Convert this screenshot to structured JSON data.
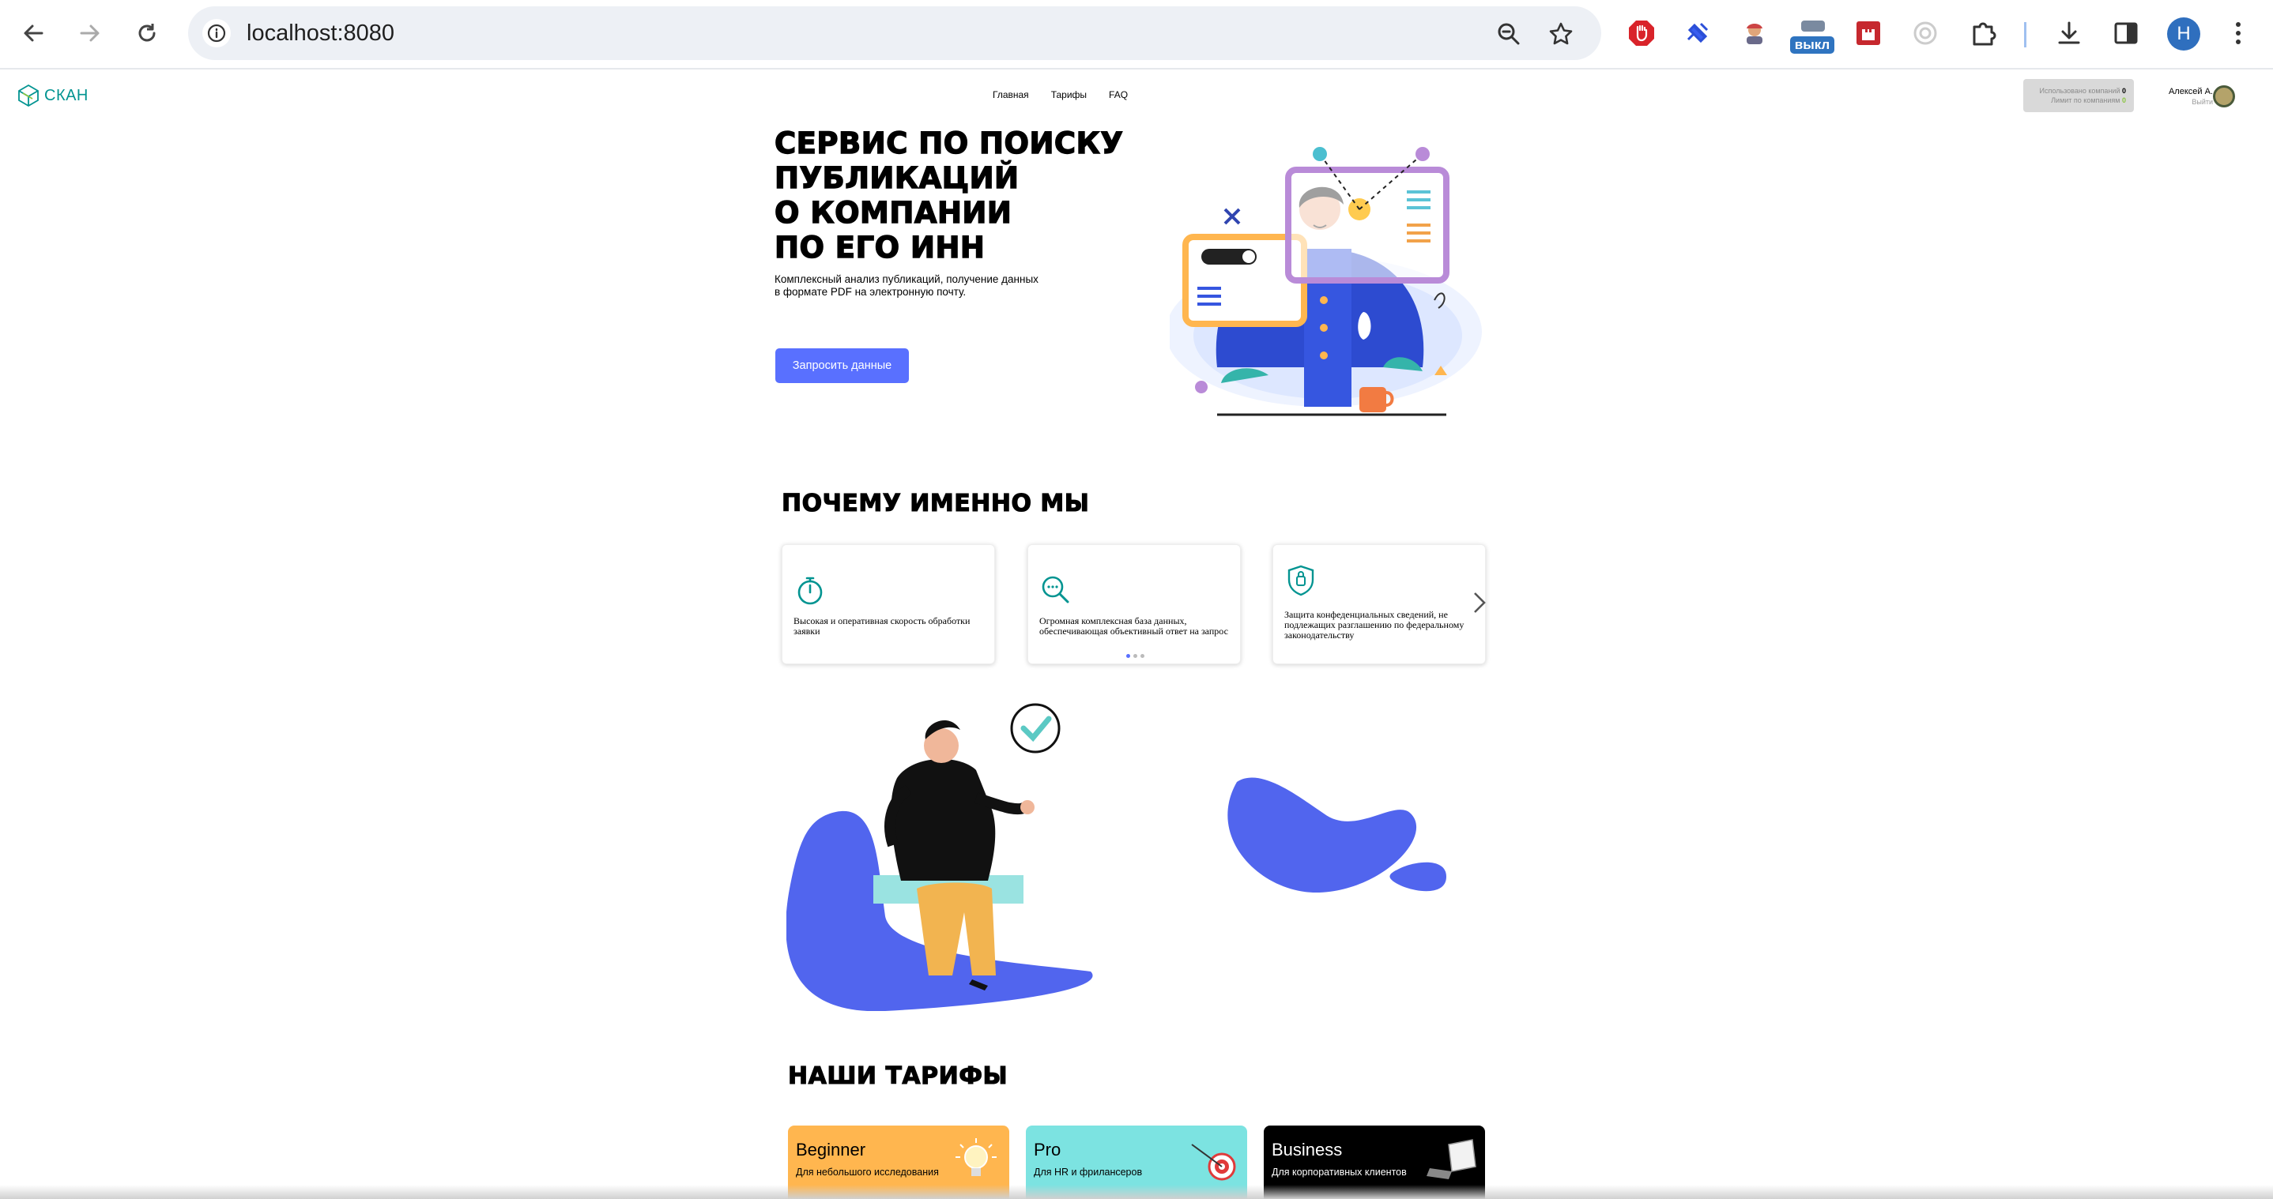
{
  "browser": {
    "url": "localhost:8080",
    "extension_badge": "выкл",
    "profile_initial": "H"
  },
  "site": {
    "logo_text": "СКАН",
    "nav": [
      "Главная",
      "Тарифы",
      "FAQ"
    ],
    "usage": {
      "used_label": "Использовано компаний",
      "used_value": "0",
      "limit_label": "Лимит по компаниям",
      "limit_value": "0"
    },
    "user": {
      "name": "Алексей А.",
      "logout": "Выйти"
    }
  },
  "hero": {
    "title_lines": [
      "СЕРВИС ПО ПОИСКУ",
      "ПУБЛИКАЦИЙ",
      "О КОМПАНИИ",
      "ПО ЕГО ИНН"
    ],
    "subtitle_lines": [
      "Комплексный анализ публикаций, получение данных",
      "в формате PDF на электронную почту."
    ],
    "cta": "Запросить данные"
  },
  "why": {
    "title": "ПОЧЕМУ ИМЕННО МЫ",
    "cards": [
      {
        "icon": "timer-icon",
        "text": "Высокая и оперативная скорость обработки заявки"
      },
      {
        "icon": "search-icon",
        "text": "Огромная комплексная база данных, обеспечивающая объективный ответ на запрос"
      },
      {
        "icon": "shield-icon",
        "text": "Защита конфеденциальных сведений, не подлежащих разглашению по федеральному законодательству"
      }
    ],
    "dots": 3,
    "active_dot": 0
  },
  "tariffs": {
    "title": "НАШИ ТАРИФЫ",
    "cards": [
      {
        "name": "Beginner",
        "desc": "Для небольшого исследования",
        "color": "#ffb64f",
        "icon": "lightbulb-icon"
      },
      {
        "name": "Pro",
        "desc": "Для HR и фрилансеров",
        "color": "#7ce3e1",
        "icon": "target-icon"
      },
      {
        "name": "Business",
        "desc": "Для корпоративных клиентов",
        "color": "#000000",
        "icon": "laptop-icon"
      }
    ]
  },
  "colors": {
    "accent": "#5970ff",
    "brand_teal": "#029491",
    "beginner": "#ffb64f",
    "pro": "#7ce3e1",
    "business": "#000000"
  }
}
